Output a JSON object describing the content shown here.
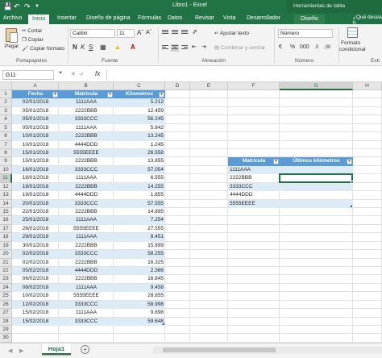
{
  "window": {
    "title": "Libro1 - Excel",
    "context_group": "Herramientas de tabla"
  },
  "tabs": [
    "Archivo",
    "Inicio",
    "Insertar",
    "Diseño de página",
    "Fórmulas",
    "Datos",
    "Revisar",
    "Vista",
    "Desarrollador",
    "Diseño"
  ],
  "tell_me": "¿Qué desea h",
  "ribbon": {
    "clipboard": {
      "paste": "Pegar",
      "cut": "Cortar",
      "copy": "Copiar",
      "format_painter": "Copiar formato",
      "label": "Portapapeles"
    },
    "font": {
      "name": "Calibri",
      "size": "11",
      "label": "Fuente"
    },
    "alignment": {
      "wrap": "Ajustar texto",
      "merge": "Combinar y centrar",
      "label": "Alineación"
    },
    "number": {
      "format": "Número",
      "label": "Número"
    },
    "styles": {
      "conditional_1": "Formato",
      "conditional_2": "condicional",
      "label": "Esti"
    }
  },
  "formula_bar": {
    "name_box": "G11",
    "fx": "fx",
    "value": ""
  },
  "grid": {
    "columns": [
      "A",
      "B",
      "C",
      "D",
      "E",
      "F",
      "G",
      "H"
    ],
    "selected_column": "G",
    "selected_row": "11",
    "rows": [
      "1",
      "2",
      "3",
      "4",
      "5",
      "6",
      "7",
      "8",
      "9",
      "10",
      "11",
      "12",
      "13",
      "14",
      "15",
      "16",
      "17",
      "18",
      "19",
      "20",
      "21",
      "22",
      "23",
      "24",
      "25",
      "26",
      "27",
      "28",
      "29",
      "30"
    ]
  },
  "table1": {
    "headers": [
      "Fecha",
      "Matrícula",
      "Kilometros"
    ],
    "rows": [
      [
        "02/01/2018",
        "1111AAA",
        "5.212"
      ],
      [
        "05/01/2018",
        "2222BBB",
        "12.459"
      ],
      [
        "05/01/2018",
        "3333CCC",
        "56.245"
      ],
      [
        "05/01/2018",
        "1111AAA",
        "5.842"
      ],
      [
        "10/01/2018",
        "2222BBB",
        "13.245"
      ],
      [
        "10/01/2018",
        "4444DDD",
        "1.245"
      ],
      [
        "15/01/2018",
        "5555EEEE",
        "26.558"
      ],
      [
        "15/01/2018",
        "2222BBB",
        "13.855"
      ],
      [
        "16/01/2018",
        "3333CCC",
        "57.054"
      ],
      [
        "18/01/2018",
        "1111AAA",
        "6.555"
      ],
      [
        "18/01/2018",
        "2222BBB",
        "14.255"
      ],
      [
        "19/01/2018",
        "4444DDD",
        "1.855"
      ],
      [
        "20/01/2018",
        "3333CCC",
        "57.555"
      ],
      [
        "22/01/2018",
        "2222BBB",
        "14.895"
      ],
      [
        "25/01/2018",
        "1111AAA",
        "7.254"
      ],
      [
        "28/01/2018",
        "5555EEEE",
        "27.555"
      ],
      [
        "29/01/2018",
        "1111AAA",
        "8.451"
      ],
      [
        "30/01/2018",
        "2222BBB",
        "15.899"
      ],
      [
        "02/02/2018",
        "3333CCC",
        "58.255"
      ],
      [
        "02/02/2018",
        "2222BBB",
        "16.325"
      ],
      [
        "05/02/2018",
        "4444DDD",
        "2.366"
      ],
      [
        "06/02/2018",
        "2222BBB",
        "16.845"
      ],
      [
        "08/02/2018",
        "1111AAA",
        "9.458"
      ],
      [
        "10/02/2018",
        "5555EEEE",
        "28.855"
      ],
      [
        "12/02/2018",
        "3333CCC",
        "58.998"
      ],
      [
        "15/02/2018",
        "1111AAA",
        "9.898"
      ],
      [
        "15/02/2018",
        "3333CCC",
        "59.648"
      ]
    ]
  },
  "table2": {
    "headers": [
      "Matrícula",
      "Últimos kilómetros"
    ],
    "rows": [
      [
        "1111AAA",
        ""
      ],
      [
        "2222BBB",
        ""
      ],
      [
        "3333CCC",
        ""
      ],
      [
        "4444DDD",
        ""
      ],
      [
        "5555EEEE",
        ""
      ]
    ]
  },
  "sheets": {
    "active": "Hoja1",
    "add": "+"
  },
  "colors": {
    "excel_green": "#217346",
    "table_header": "#5b9bd5",
    "table_band": "#ddebf7"
  }
}
